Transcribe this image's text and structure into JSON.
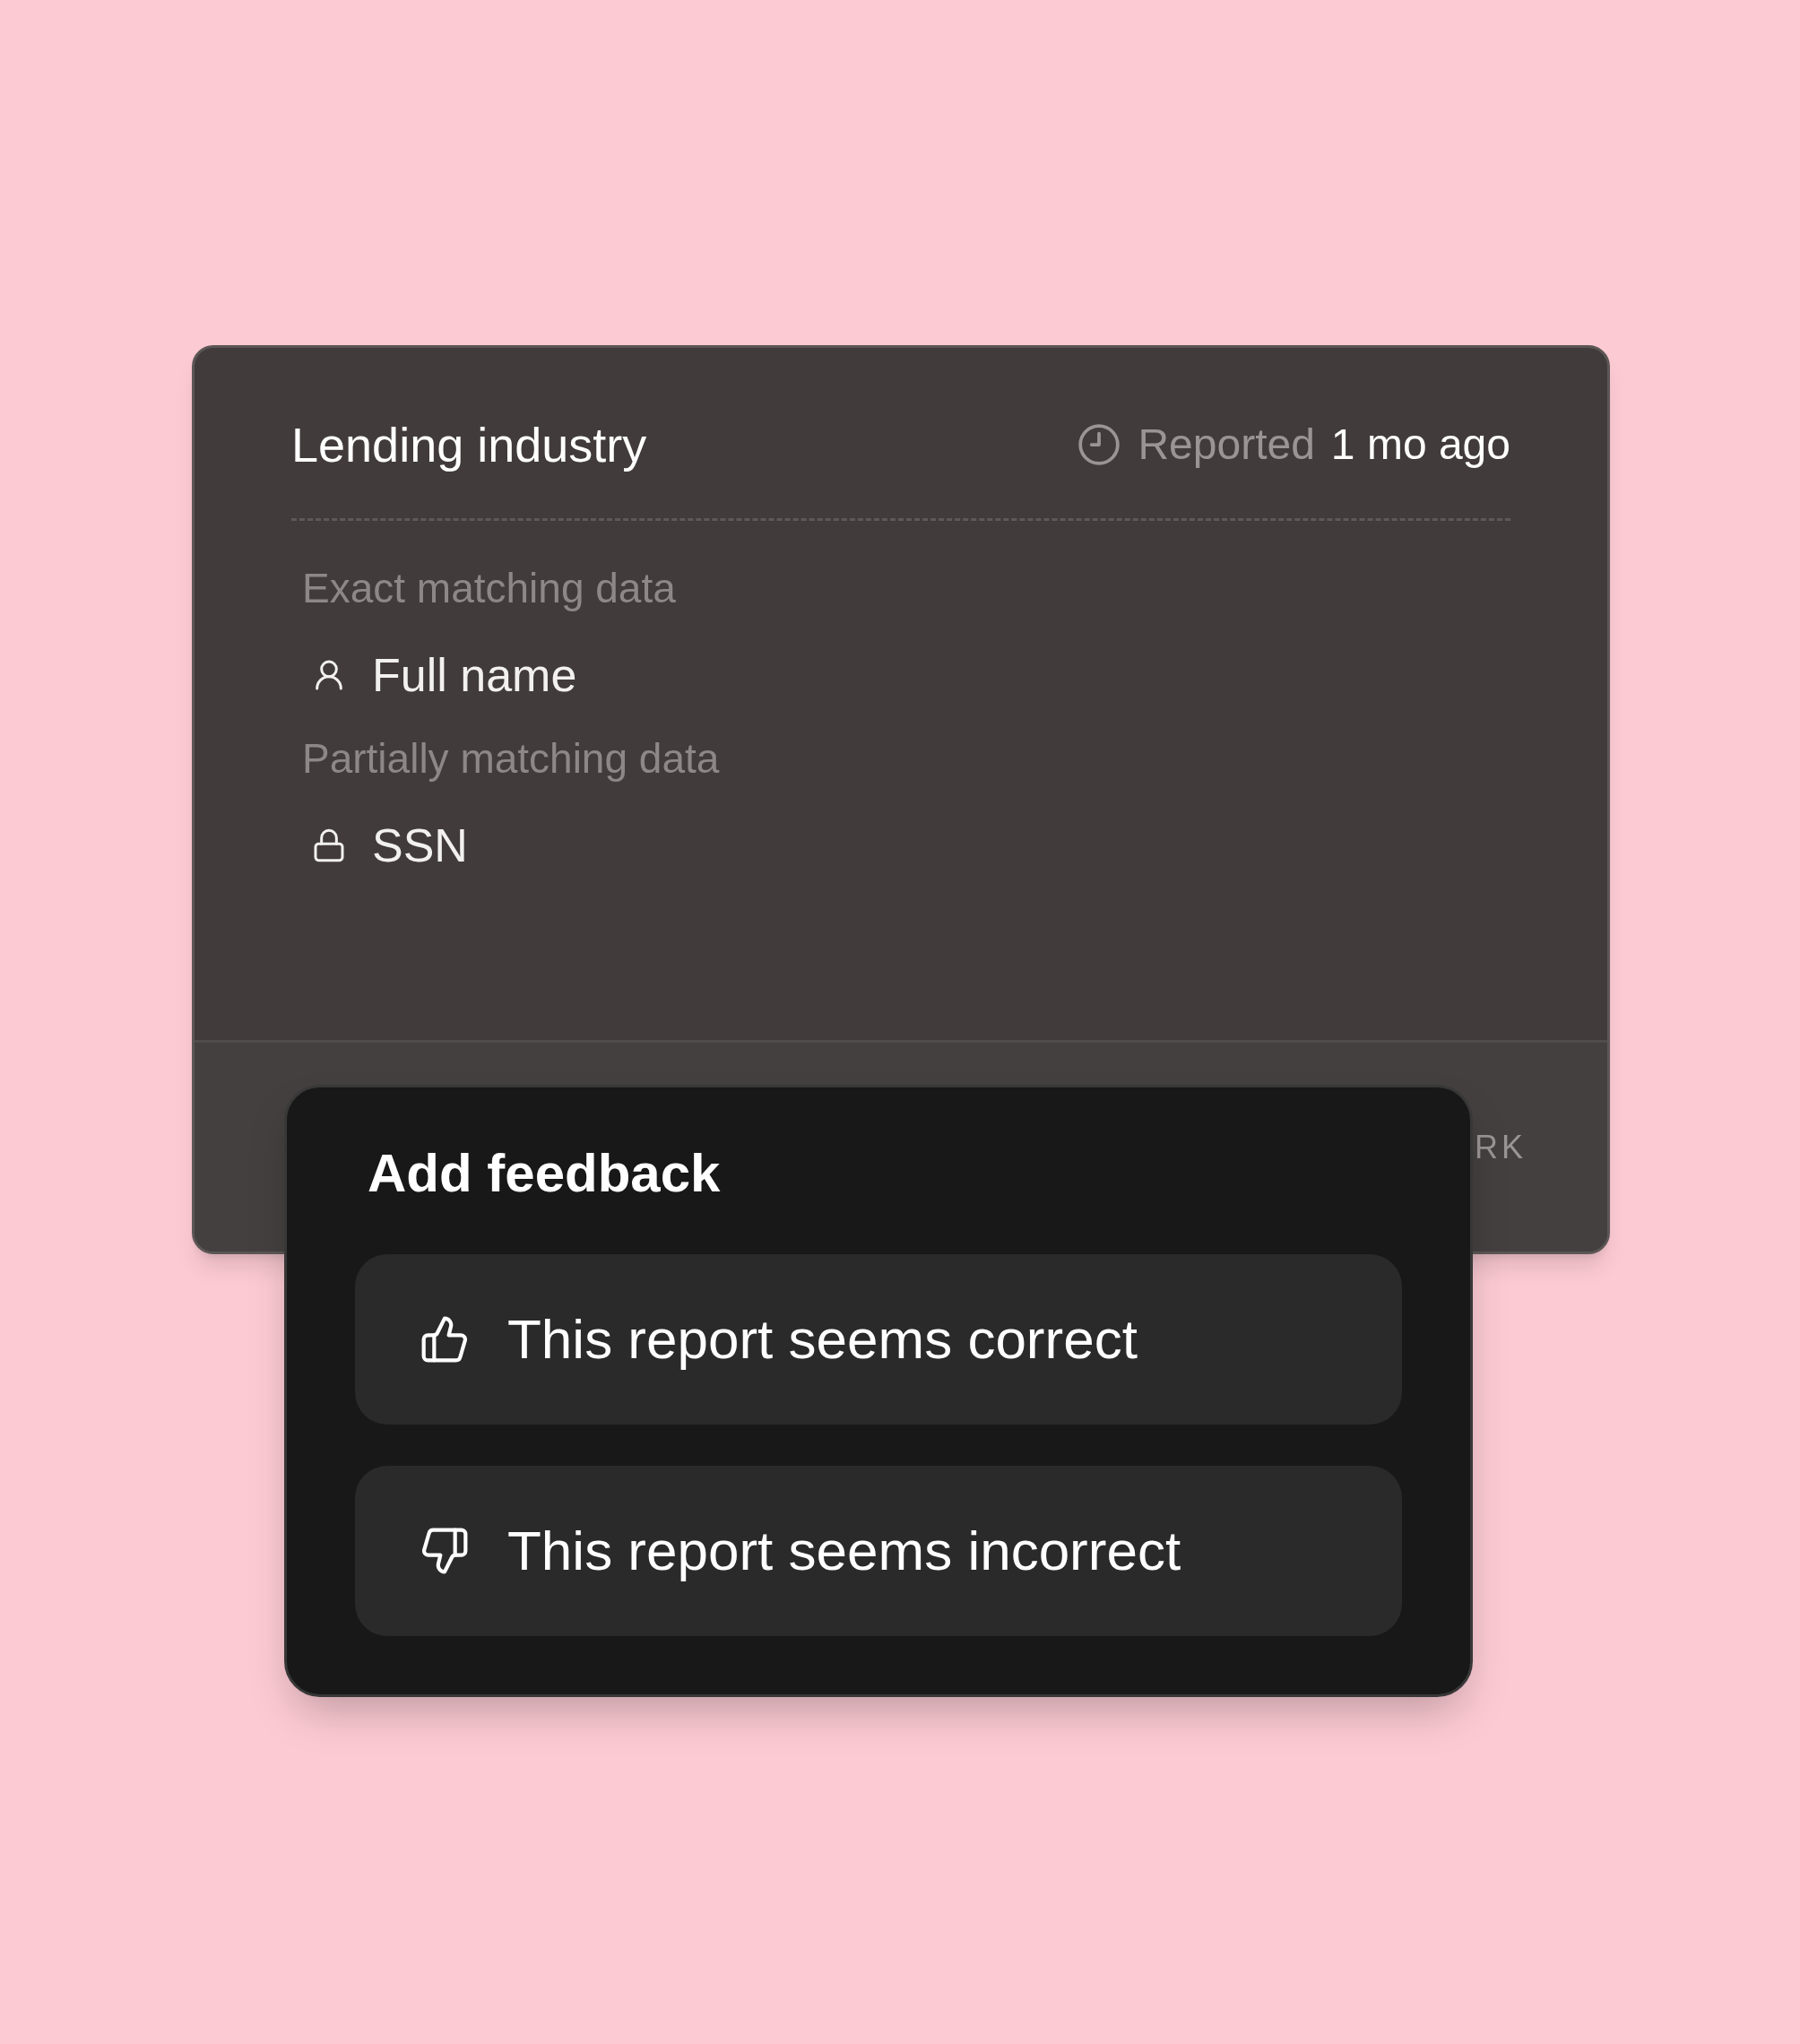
{
  "card": {
    "title": "Lending industry",
    "reported": {
      "label": "Reported",
      "time": "1 mo ago"
    },
    "sections": [
      {
        "heading": "Exact matching data",
        "items": [
          {
            "kind": "person",
            "label": "Full name"
          }
        ]
      },
      {
        "heading": "Partially matching data",
        "items": [
          {
            "kind": "lock",
            "label": "SSN"
          }
        ]
      }
    ],
    "footer": {
      "text": "RK"
    }
  },
  "feedback_popup": {
    "title": "Add feedback",
    "options": [
      {
        "kind": "positive",
        "label": "This report seems correct"
      },
      {
        "kind": "negative",
        "label": "This report seems incorrect"
      }
    ]
  }
}
